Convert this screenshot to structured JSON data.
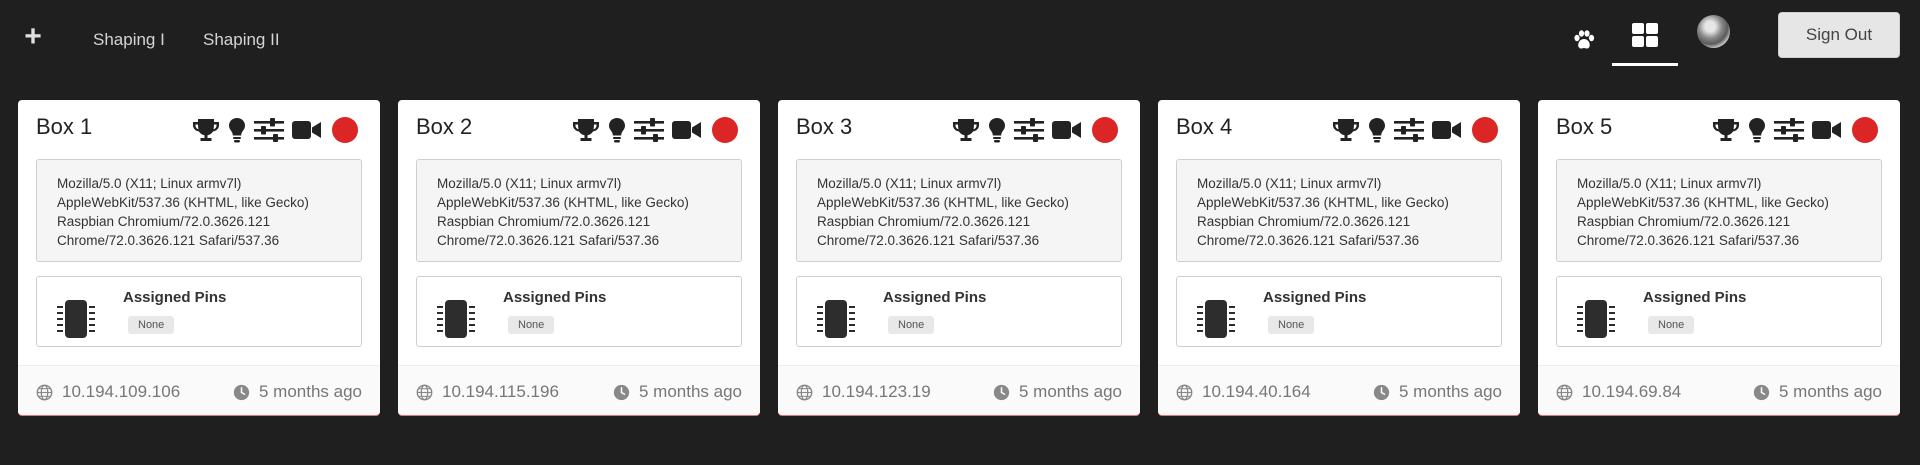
{
  "nav": {
    "add_icon": "plus-icon",
    "links": [
      {
        "label": "Shaping I"
      },
      {
        "label": "Shaping II"
      }
    ],
    "paw_icon": "paw-icon",
    "grid_icon": "grid-view-icon",
    "avatar_icon": "user-avatar",
    "sign_out": "Sign Out"
  },
  "colors": {
    "background": "#1f1f1f",
    "status_offline": "#dc2626",
    "card_border": "#e57373"
  },
  "card_common": {
    "icons": [
      "trophy-icon",
      "lightbulb-icon",
      "sliders-icon",
      "video-camera-icon",
      "status-dot"
    ],
    "user_agent_lines": [
      "Mozilla/5.0 (X11; Linux armv7l)",
      "AppleWebKit/537.36 (KHTML, like Gecko)",
      "Raspbian Chromium/72.0.3626.121",
      "Chrome/72.0.3626.121 Safari/537.36"
    ],
    "pins_label": "Assigned Pins",
    "pins_value": "None"
  },
  "cards": [
    {
      "title": "Box 1",
      "ip": "10.194.109.106",
      "last_seen": "5 months ago"
    },
    {
      "title": "Box 2",
      "ip": "10.194.115.196",
      "last_seen": "5 months ago"
    },
    {
      "title": "Box 3",
      "ip": "10.194.123.19",
      "last_seen": "5 months ago"
    },
    {
      "title": "Box 4",
      "ip": "10.194.40.164",
      "last_seen": "5 months ago"
    },
    {
      "title": "Box 5",
      "ip": "10.194.69.84",
      "last_seen": "5 months ago"
    }
  ]
}
